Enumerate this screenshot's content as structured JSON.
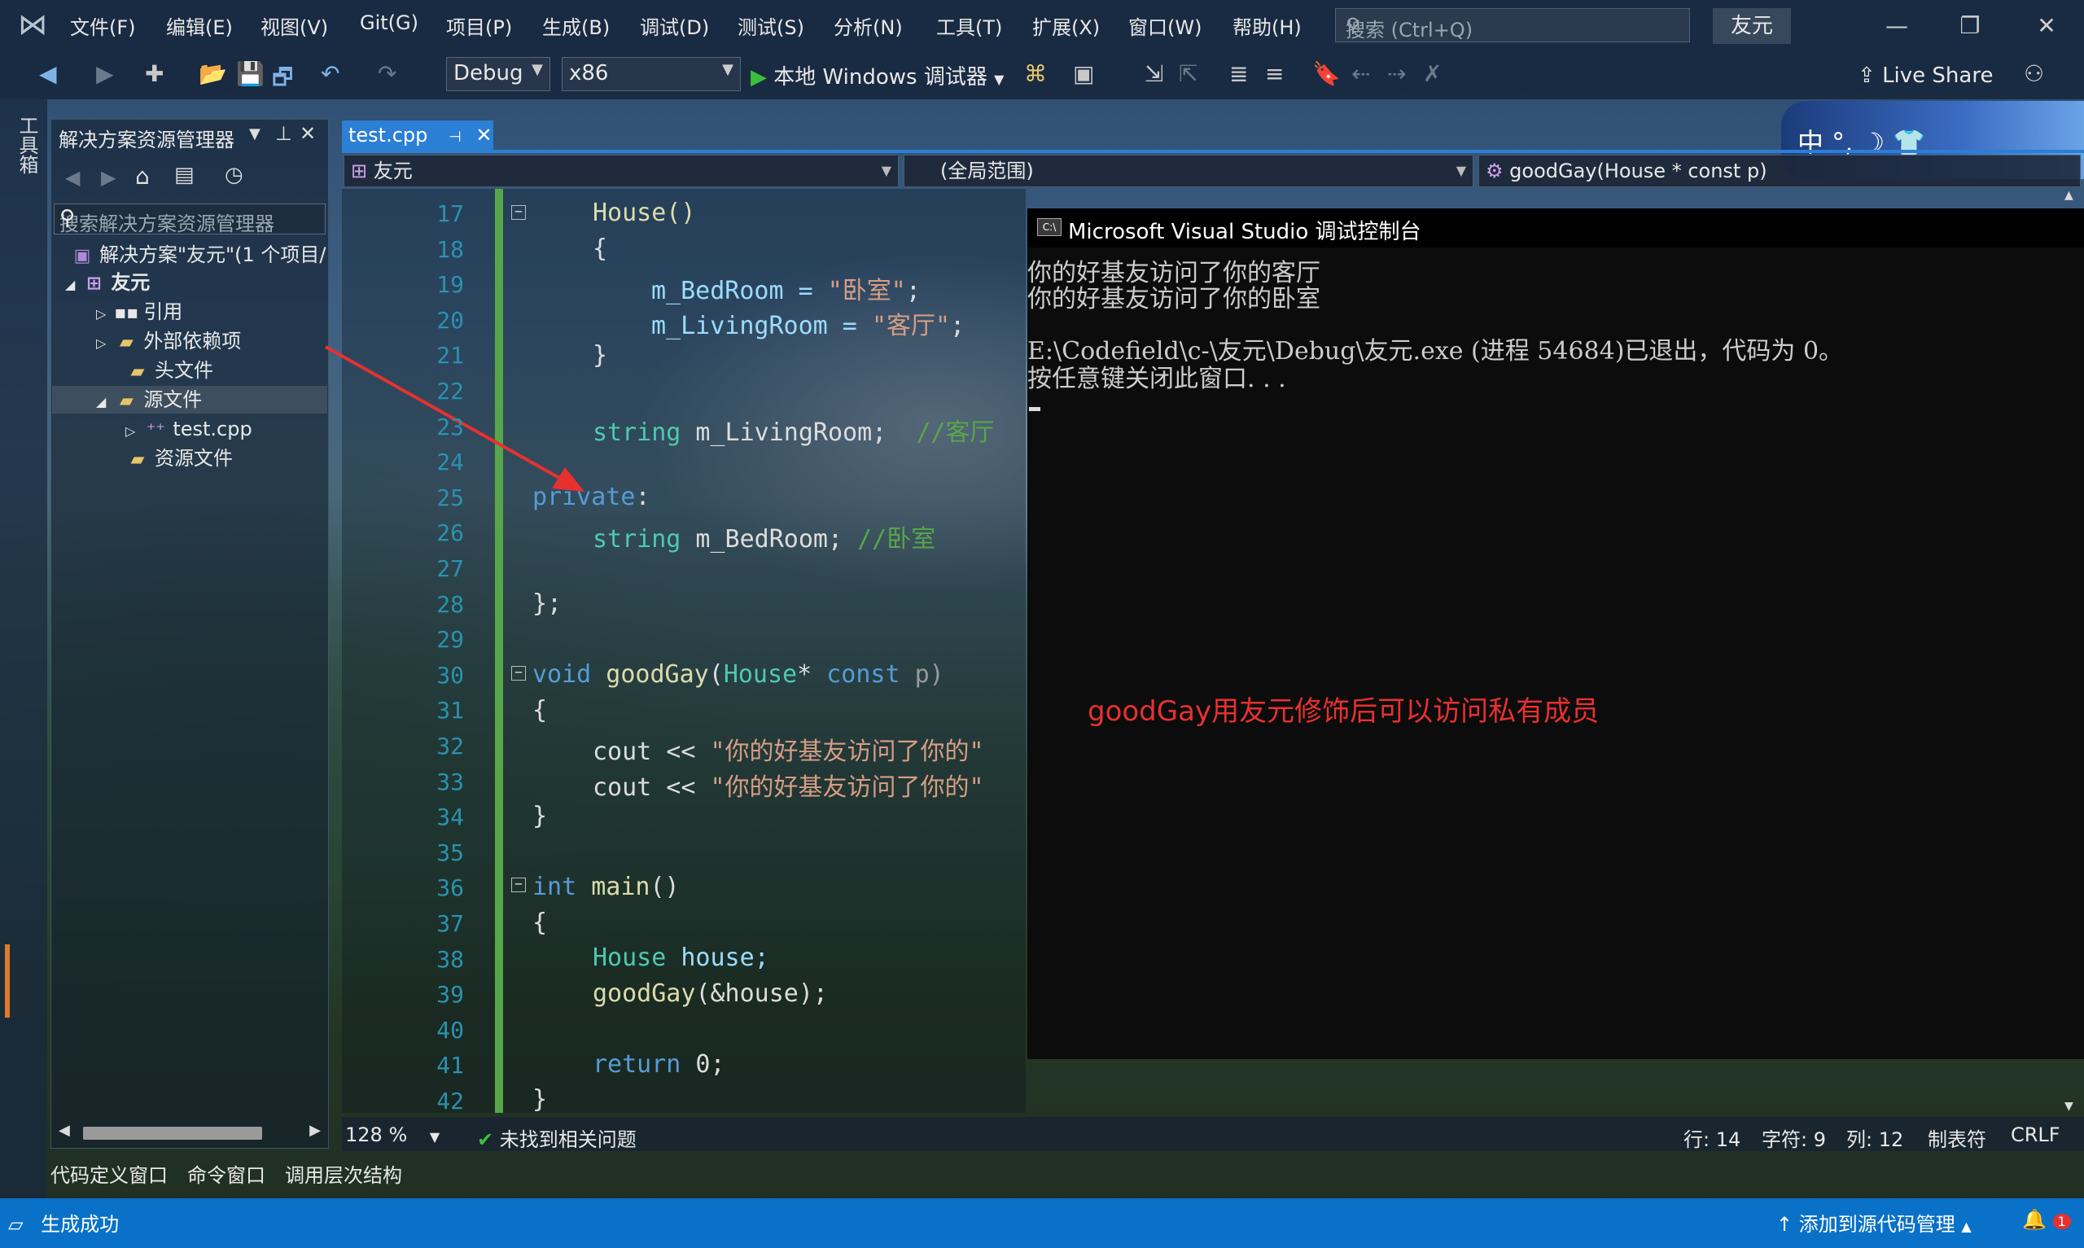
{
  "menu": {
    "items": [
      "文件(F)",
      "编辑(E)",
      "视图(V)",
      "Git(G)",
      "项目(P)",
      "生成(B)",
      "调试(D)",
      "测试(S)",
      "分析(N)",
      "工具(T)",
      "扩展(X)",
      "窗口(W)",
      "帮助(H)"
    ],
    "search_placeholder": "搜索 (Ctrl+Q)",
    "solution_badge": "友元"
  },
  "toolbar": {
    "config": "Debug",
    "platform": "x86",
    "run_label": "本地 Windows 调试器",
    "live_share": "Live Share"
  },
  "toolbox_label": "工具箱",
  "solution_explorer": {
    "title": "解决方案资源管理器",
    "search_placeholder": "搜索解决方案资源管理器",
    "tree": [
      {
        "label": "解决方案\"友元\"(1 个项目/",
        "icon": "solution-icon"
      },
      {
        "label": "友元",
        "icon": "project-icon",
        "bold": true
      },
      {
        "label": "引用",
        "icon": "references-icon"
      },
      {
        "label": "外部依赖项",
        "icon": "folder-icon"
      },
      {
        "label": "头文件",
        "icon": "folder-icon"
      },
      {
        "label": "源文件",
        "icon": "folder-icon",
        "selected": true
      },
      {
        "label": "test.cpp",
        "icon": "cpp-file-icon"
      },
      {
        "label": "资源文件",
        "icon": "folder-icon"
      }
    ]
  },
  "editor": {
    "tab": "test.cpp",
    "nav_project": "友元",
    "nav_scope": "(全局范围)",
    "nav_member": "goodGay(House * const p)",
    "line_numbers": [
      "17",
      "18",
      "19",
      "20",
      "21",
      "22",
      "23",
      "24",
      "25",
      "26",
      "27",
      "28",
      "29",
      "30",
      "31",
      "32",
      "33",
      "34",
      "35",
      "36",
      "37",
      "38",
      "39",
      "40",
      "41",
      "42"
    ],
    "zoom": "128 %",
    "issues": "未找到相关问题",
    "row": "行: 14",
    "char": "字符: 9",
    "col": "列: 12",
    "indent": "制表符",
    "eol": "CRLF"
  },
  "code": {
    "l17": "House()",
    "l18": "{",
    "l19a": "m_BedRoom = ",
    "l19b": "\"卧室\"",
    "l19c": ";",
    "l20a": "m_LivingRoom = ",
    "l20b": "\"客厅\"",
    "l20c": ";",
    "l21": "}",
    "l23a": "string",
    "l23b": " m_LivingRoom;  ",
    "l23c": "//客厅",
    "l25a": "private",
    "l25b": ":",
    "l26a": "string",
    "l26b": " m_BedRoom; ",
    "l26c": "//卧室",
    "l28": "};",
    "l30a": "void",
    "l30b": " goodGay",
    "l30c": "(",
    "l30d": "House",
    "l30e": "* ",
    "l30f": "const",
    "l30g": " p)",
    "l31": "{",
    "l32a": "cout << ",
    "l32b": "\"你的好基友访问了你的\"",
    "l33a": "cout << ",
    "l33b": "\"你的好基友访问了你的\"",
    "l34": "}",
    "l36a": "int",
    "l36b": " main",
    "l36c": "()",
    "l37": "{",
    "l38a": "House",
    "l38b": " house;",
    "l39a": "goodGay",
    "l39b": "(&house);",
    "l41a": "return",
    "l41b": " 0;",
    "l42": "}"
  },
  "console": {
    "title": "Microsoft Visual Studio 调试控制台",
    "lines": [
      "你的好基友访问了你的客厅",
      "你的好基友访问了你的卧室",
      "",
      "E:\\Codefield\\c-\\友元\\Debug\\友元.exe (进程 54684)已退出，代码为 0。",
      "按任意键关闭此窗口. . ."
    ]
  },
  "annotation": "goodGay用友元修饰后可以访问私有成员",
  "deco": "中 °, ☽ 👕",
  "bottom_tabs": [
    "代码定义窗口",
    "命令窗口",
    "调用层次结构"
  ],
  "status": {
    "build": "生成成功",
    "source_control": "添加到源代码管理",
    "notifications": "1"
  }
}
